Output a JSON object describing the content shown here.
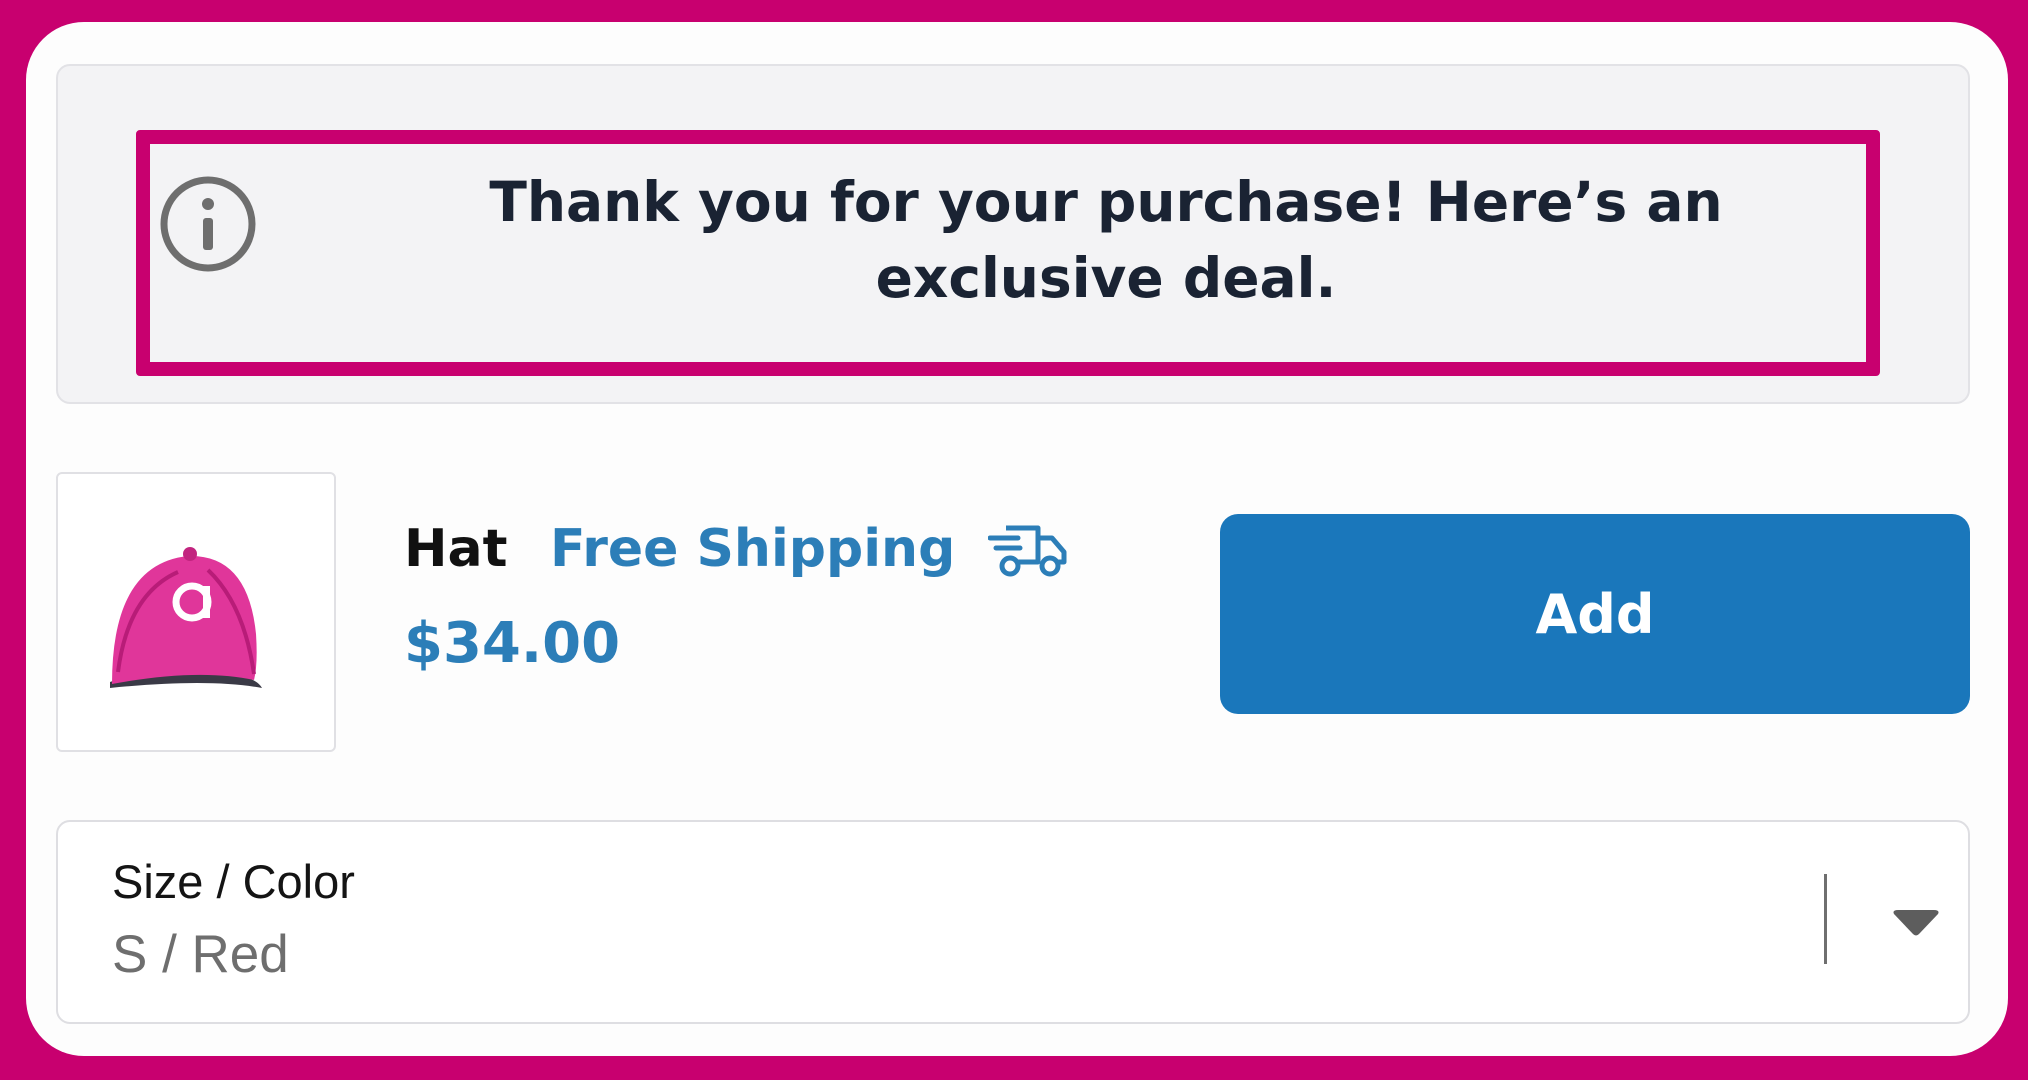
{
  "banner": {
    "message": "Thank you for your purchase! Here’s an exclusive deal.",
    "icon": "info-icon",
    "highlight_color": "#c8006f"
  },
  "product": {
    "name": "Hat",
    "shipping_label": "Free Shipping",
    "shipping_icon": "truck-icon",
    "price": "$34.00",
    "image": "pink-cap-image",
    "accent_color": "#2c7eb8"
  },
  "actions": {
    "add_label": "Add",
    "button_color": "#1a77bb"
  },
  "variant_select": {
    "label": "Size / Color",
    "value": "S / Red",
    "icon": "chevron-down-icon"
  }
}
